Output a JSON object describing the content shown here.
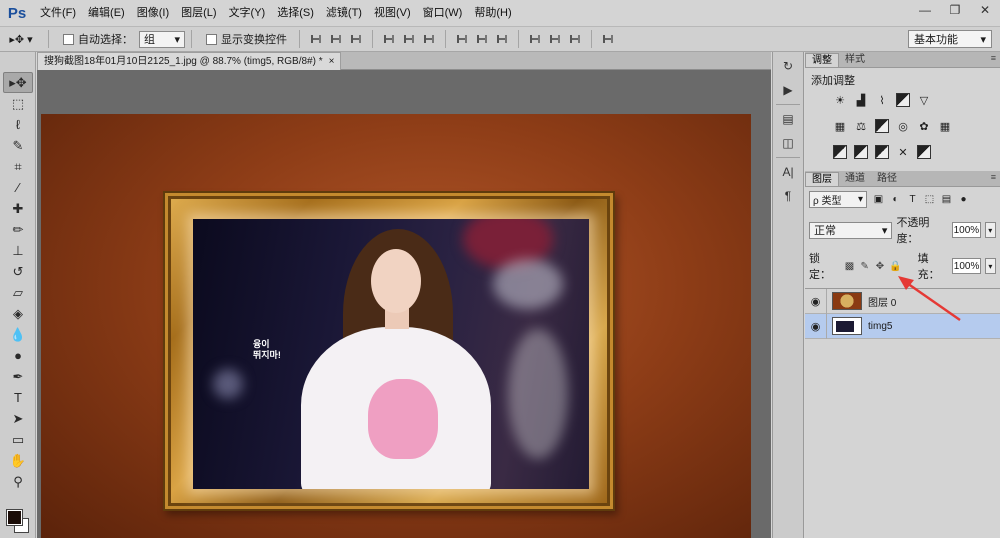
{
  "app": {
    "logo": "Ps",
    "menu": [
      "文件(F)",
      "编辑(E)",
      "图像(I)",
      "图层(L)",
      "文字(Y)",
      "选择(S)",
      "滤镜(T)",
      "视图(V)",
      "窗口(W)",
      "帮助(H)"
    ],
    "window_buttons": {
      "minimize": "—",
      "restore": "❐",
      "close": "✕"
    }
  },
  "options": {
    "auto_select_label": "自动选择：",
    "auto_select_value": "组",
    "show_transform_label": "显示变换控件",
    "workspace": "基本功能"
  },
  "document": {
    "tab_title": "搜狗截图18年01月10日2125_1.jpg @ 88.7% (timg5, RGB/8#) *",
    "close": "×",
    "photo_text": [
      "융이",
      "뛰지마!"
    ]
  },
  "panels": {
    "adjust_tabs": [
      "调整",
      "样式"
    ],
    "adjust_title": "添加调整",
    "layer_tabs": [
      "图层",
      "通道",
      "路径"
    ],
    "filter_kind": "ρ 类型",
    "blend_mode": "正常",
    "opacity_label": "不透明度：",
    "opacity": "100%",
    "lock_label": "锁定：",
    "fill_label": "填充：",
    "fill": "100%",
    "layers": [
      {
        "name": "图层 0",
        "selected": false
      },
      {
        "name": "timg5",
        "selected": true
      }
    ]
  },
  "colors": {
    "accent_selected_layer": "#b5cbee",
    "annotation_arrow": "#e53935",
    "foreground": "#1b0d08",
    "background": "#ffffff"
  }
}
